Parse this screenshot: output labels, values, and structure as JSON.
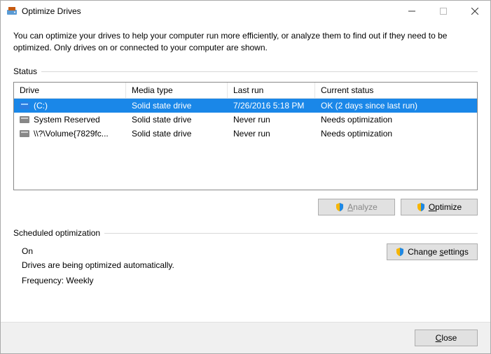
{
  "window": {
    "title": "Optimize Drives"
  },
  "description": "You can optimize your drives to help your computer run more efficiently, or analyze them to find out if they need to be optimized. Only drives on or connected to your computer are shown.",
  "status_label": "Status",
  "columns": {
    "drive": "Drive",
    "media": "Media type",
    "last": "Last run",
    "status": "Current status"
  },
  "rows": [
    {
      "drive": "(C:)",
      "media": "Solid state drive",
      "last": "7/26/2016 5:18 PM",
      "status": "OK (2 days since last run)",
      "selected": true
    },
    {
      "drive": "System Reserved",
      "media": "Solid state drive",
      "last": "Never run",
      "status": "Needs optimization",
      "selected": false
    },
    {
      "drive": "\\\\?\\Volume{7829fc...",
      "media": "Solid state drive",
      "last": "Never run",
      "status": "Needs optimization",
      "selected": false
    }
  ],
  "buttons": {
    "analyze_pre": "A",
    "analyze_post": "nalyze",
    "optimize_pre": "O",
    "optimize_post": "ptimize",
    "change_pre": "Change ",
    "change_u": "s",
    "change_post": "ettings",
    "close_pre": "C",
    "close_post": "lose"
  },
  "scheduled": {
    "label": "Scheduled optimization",
    "state": "On",
    "desc": "Drives are being optimized automatically.",
    "freq": "Frequency: Weekly"
  }
}
